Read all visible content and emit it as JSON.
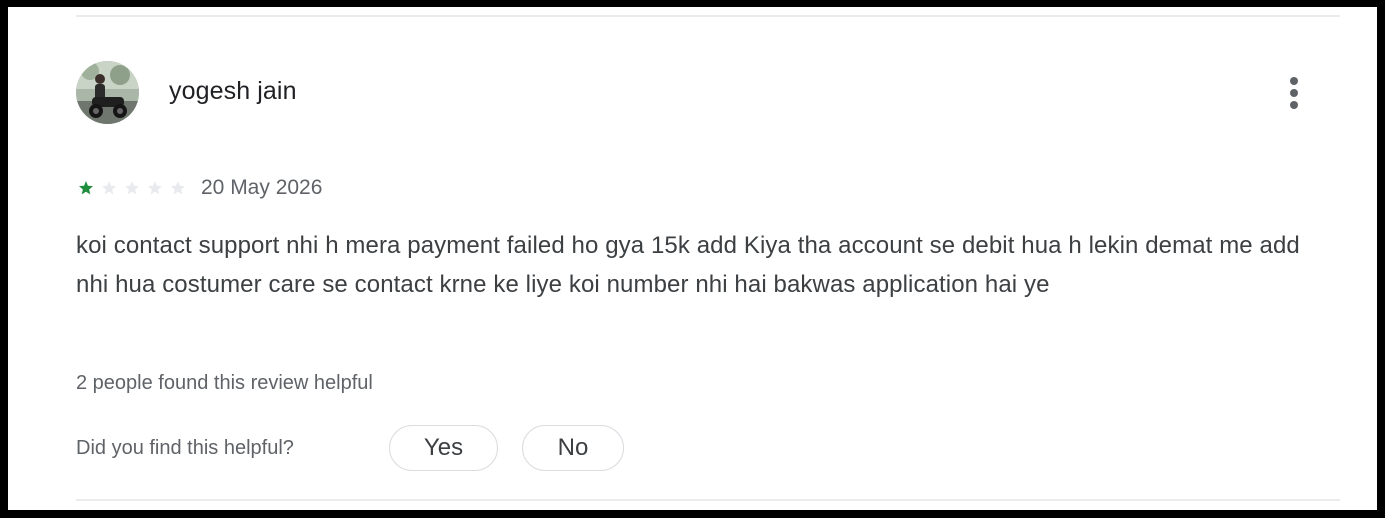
{
  "review": {
    "reviewer_name": "yogesh jain",
    "rating": 1,
    "max_rating": 5,
    "date": "20 May 2026",
    "text": "koi contact support nhi h mera payment failed ho gya 15k add Kiya tha account se debit hua h lekin demat me add nhi hua costumer care se contact krne ke liye koi number nhi hai bakwas application hai ye",
    "helpful_count_text": "2 people found this review helpful",
    "feedback_question": "Did you find this helpful?",
    "yes_label": "Yes",
    "no_label": "No"
  },
  "icons": {
    "more": "more-vert-icon",
    "star": "star-icon"
  },
  "colors": {
    "star_filled": "#1e8e3e",
    "star_empty": "#e8eaed"
  }
}
